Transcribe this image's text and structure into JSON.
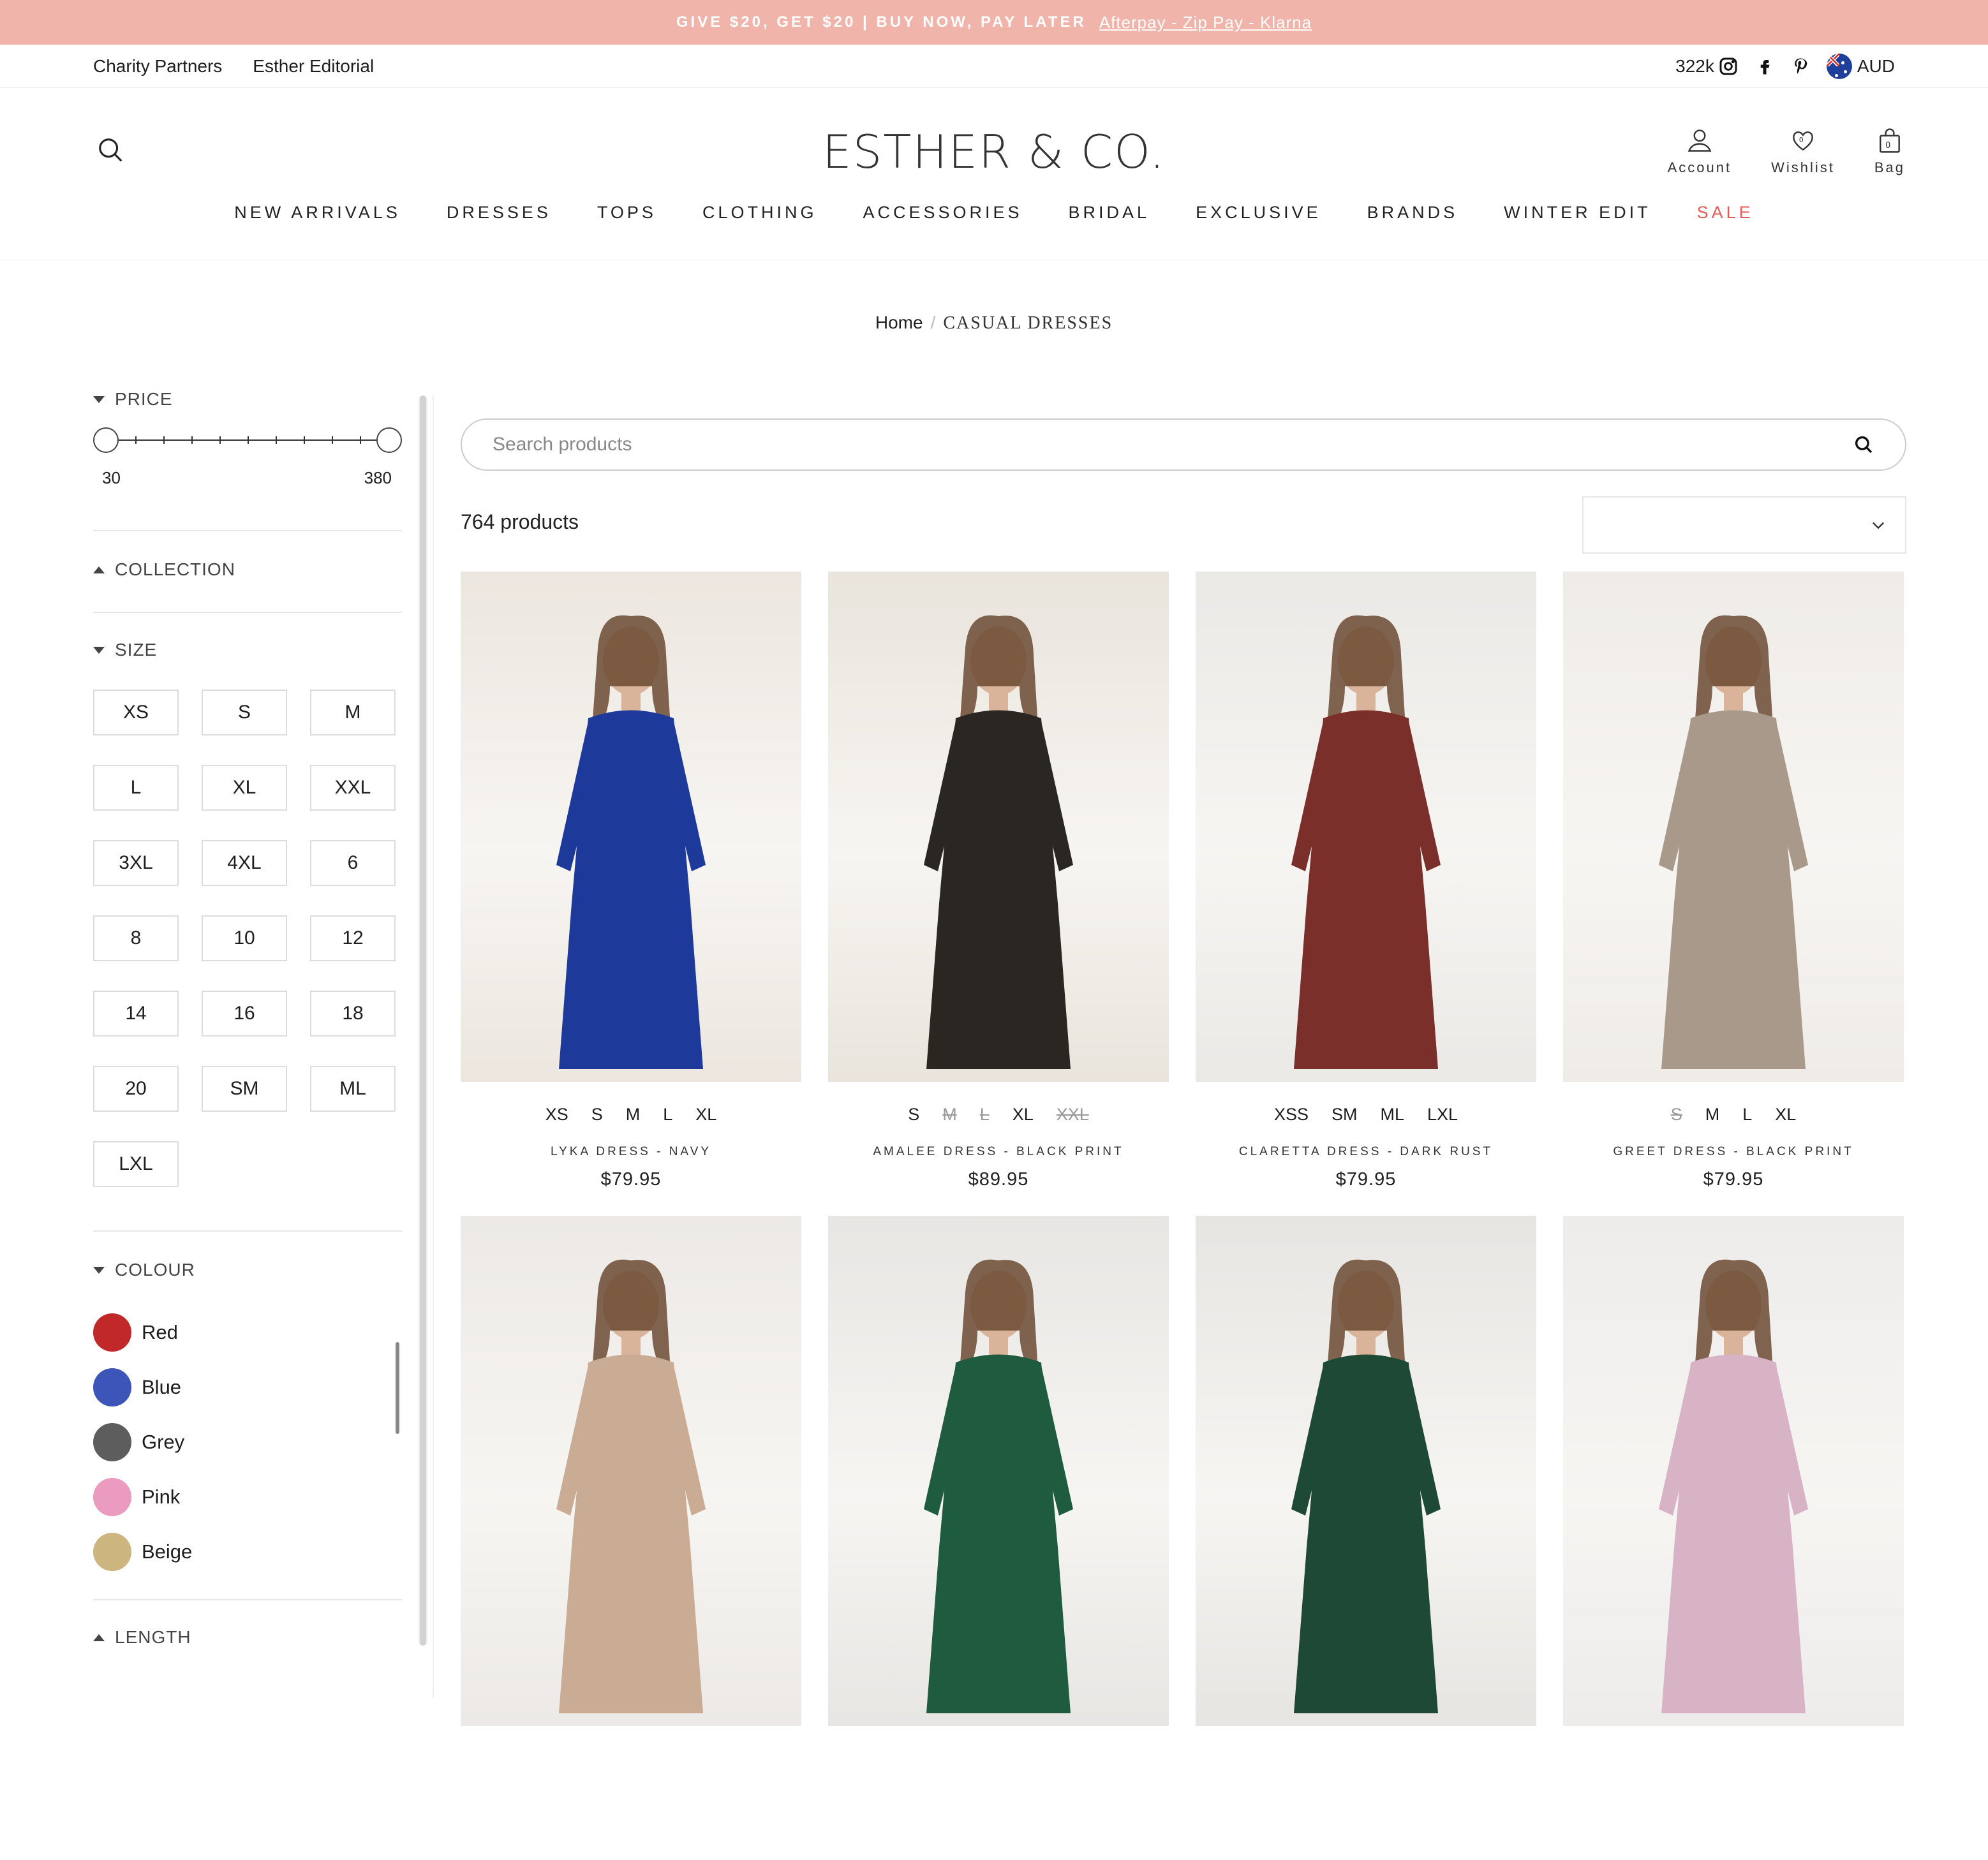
{
  "announcement": {
    "text": "GIVE $20, GET $20 | BUY NOW, PAY LATER",
    "link": "Afterpay - Zip Pay - Klarna"
  },
  "utility": {
    "links": [
      "Charity Partners",
      "Esther Editorial"
    ],
    "followers": "322k",
    "currency": "AUD"
  },
  "header": {
    "logo": "ESTHER & CO.",
    "icons": [
      {
        "name": "account-icon",
        "label": "Account"
      },
      {
        "name": "wishlist-icon",
        "label": "Wishlist",
        "count": "0"
      },
      {
        "name": "bag-icon",
        "label": "Bag",
        "count": "0"
      }
    ],
    "nav": [
      "NEW ARRIVALS",
      "DRESSES",
      "TOPS",
      "CLOTHING",
      "ACCESSORIES",
      "BRIDAL",
      "EXCLUSIVE",
      "BRANDS",
      "WINTER EDIT",
      "SALE"
    ]
  },
  "breadcrumb": {
    "home": "Home",
    "separator": "/",
    "current": "CASUAL DRESSES"
  },
  "filters": {
    "price": {
      "label": "PRICE",
      "min": "30",
      "max": "380",
      "ticks": 10
    },
    "collection": {
      "label": "COLLECTION"
    },
    "size": {
      "label": "SIZE",
      "options": [
        "XS",
        "S",
        "M",
        "L",
        "XL",
        "XXL",
        "3XL",
        "4XL",
        "6",
        "8",
        "10",
        "12",
        "14",
        "16",
        "18",
        "20",
        "SM",
        "ML",
        "LXL"
      ]
    },
    "colour": {
      "label": "COLOUR",
      "options": [
        {
          "name": "Red",
          "hex": "#c0282a"
        },
        {
          "name": "Blue",
          "hex": "#3d55b8"
        },
        {
          "name": "Grey",
          "hex": "#5d5d5d"
        },
        {
          "name": "Pink",
          "hex": "#eb9bc0"
        },
        {
          "name": "Beige",
          "hex": "#cdb580"
        }
      ]
    },
    "length": {
      "label": "LENGTH"
    }
  },
  "search": {
    "placeholder": "Search products"
  },
  "product_count": "764 products",
  "products": [
    {
      "name": "LYKA DRESS - NAVY",
      "price": "$79.95",
      "dress": "#1d3a9a",
      "bg": "#ece6df",
      "sizes": [
        {
          "s": "XS",
          "oos": false
        },
        {
          "s": "S",
          "oos": false
        },
        {
          "s": "M",
          "oos": false
        },
        {
          "s": "L",
          "oos": false
        },
        {
          "s": "XL",
          "oos": false
        }
      ]
    },
    {
      "name": "AMALEE DRESS - BLACK PRINT",
      "price": "$89.95",
      "dress": "#2a2622",
      "bg": "#e9e4dc",
      "sizes": [
        {
          "s": "S",
          "oos": false
        },
        {
          "s": "M",
          "oos": true
        },
        {
          "s": "L",
          "oos": true
        },
        {
          "s": "XL",
          "oos": false
        },
        {
          "s": "XXL",
          "oos": true
        }
      ]
    },
    {
      "name": "CLARETTA DRESS - DARK RUST",
      "price": "$79.95",
      "dress": "#7a2f2a",
      "bg": "#ebe9e6",
      "sizes": [
        {
          "s": "XSS",
          "oos": false
        },
        {
          "s": "SM",
          "oos": false
        },
        {
          "s": "ML",
          "oos": false
        },
        {
          "s": "LXL",
          "oos": false
        }
      ]
    },
    {
      "name": "GREET DRESS - BLACK PRINT",
      "price": "$79.95",
      "dress": "#a8998a",
      "bg": "#efece8",
      "sizes": [
        {
          "s": "S",
          "oos": true
        },
        {
          "s": "M",
          "oos": false
        },
        {
          "s": "L",
          "oos": false
        },
        {
          "s": "XL",
          "oos": false
        }
      ]
    },
    {
      "name": "",
      "price": "",
      "dress": "#c9ac93",
      "bg": "#ece9e6",
      "sizes": []
    },
    {
      "name": "",
      "price": "",
      "dress": "#1f5b3f",
      "bg": "#e8e6e3",
      "sizes": []
    },
    {
      "name": "",
      "price": "",
      "dress": "#1e4a35",
      "bg": "#e7e5e2",
      "sizes": []
    },
    {
      "name": "",
      "price": "",
      "dress": "#d8b3c6",
      "bg": "#eeeceb",
      "sizes": []
    }
  ],
  "colors": {
    "announce_bg": "#f0b4aa",
    "sale": "#e55a55"
  }
}
